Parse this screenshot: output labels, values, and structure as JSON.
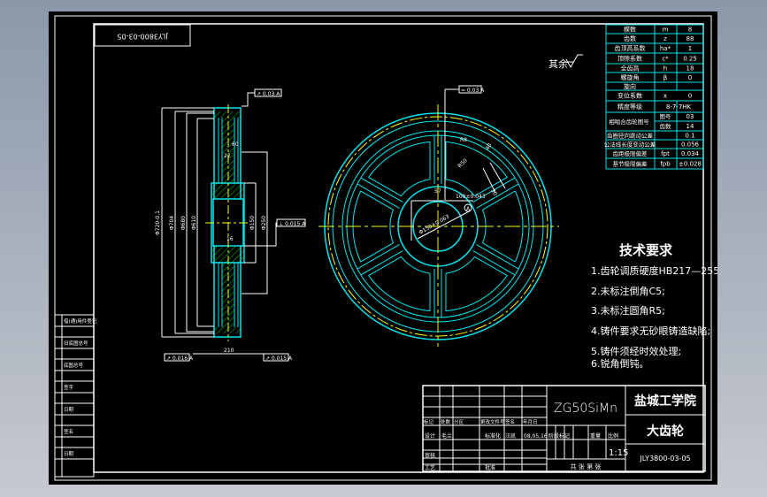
{
  "colors": {
    "background": "#000000",
    "frame": "#ffffff",
    "outline": "#00e5ee",
    "centerline": "#ffff00",
    "hatch": "#00ff00"
  },
  "drawing_code_rotated": "JLY3800-03-05",
  "roughness_note": "其余",
  "param_table": {
    "rows": [
      {
        "name": "模数",
        "symbol": "m",
        "value": "8"
      },
      {
        "name": "齿数",
        "symbol": "z",
        "value": "88"
      },
      {
        "name": "齿顶高系数",
        "symbol": "ha*",
        "value": "1"
      },
      {
        "name": "顶隙系数",
        "symbol": "c*",
        "value": "0.25"
      },
      {
        "name": "全齿高",
        "symbol": "h",
        "value": "18"
      },
      {
        "name": "螺旋角",
        "symbol": "β",
        "value": "0"
      },
      {
        "name": "旋向",
        "symbol": "",
        "value": ""
      },
      {
        "name": "变位系数",
        "symbol": "x",
        "value": "0"
      }
    ],
    "accuracy": {
      "name": "精度等级",
      "value": "8-7-7HK"
    },
    "mating": {
      "name": "相啮合齿轮图号",
      "sub1": "图号",
      "val1": "03",
      "sub2": "齿数",
      "val2": "14"
    },
    "tolerances": [
      {
        "name": "齿圈径向跳动公差",
        "symbol": "",
        "value": "0.1"
      },
      {
        "name": "公法线长度变动公差",
        "symbol": "",
        "value": "0.056"
      },
      {
        "name": "齿距极限偏差",
        "symbol": "fpt",
        "value": "0.034"
      },
      {
        "name": "基节极限偏差",
        "symbol": "fpb",
        "value": "±0.028"
      }
    ]
  },
  "tech_requirements": {
    "title": "技术要求",
    "items": [
      "1.齿轮调质硬度HB217—255;",
      "2.未标注倒角C5;",
      "3.未标注圆角R5;",
      "4.铸件要求无砂眼铸造缺陷;",
      "5.铸件须经时效处理;",
      "6.锐角倒钝。"
    ]
  },
  "section_dims": {
    "d1": "Φ720-0.1",
    "d2": "Φ704",
    "d3": "Φ680",
    "d4": "Φ610",
    "d5": "Φ250",
    "d6": "Φ150",
    "width": "210",
    "web": "60",
    "rim": "22",
    "chamfer": "16",
    "tol_top": "↗ 0.03 A",
    "tol_right": "⊥ 0.015 A",
    "tol_bl": "↗ 0.016 A",
    "tol_br": "↗ 0.015 A"
  },
  "front_dims": {
    "tol": "= 0.03 A",
    "bore": "Φ150+0.063",
    "key": "100±0.043",
    "keyw": "57",
    "datum": "A",
    "r1": "R8",
    "r2": "R50",
    "w1": "40",
    "w2": "30",
    "h": "C3"
  },
  "left_strip": [
    "借(通)用件登记",
    "旧底图总号",
    "底图总号",
    "签字",
    "日期",
    "签名",
    "日期"
  ],
  "title_block": {
    "material": "ZG50SiMn",
    "school": "盐城工学院",
    "part_name": "大齿轮",
    "drawing_no": "JLY3800-03-05",
    "scale": "1:15",
    "row_labels": [
      "标记",
      "处数",
      "分区",
      "更改文件号",
      "签名",
      "年月日"
    ],
    "design": "设计",
    "designer": "毛兰",
    "standard": "标准化",
    "std_name": "汪凯",
    "date": "08,05,16",
    "stage": "阶段标记",
    "weight": "重量",
    "ratio": "比例",
    "review": "审核",
    "process": "工艺",
    "approve": "批准",
    "sheets": "共  张  第  张"
  }
}
